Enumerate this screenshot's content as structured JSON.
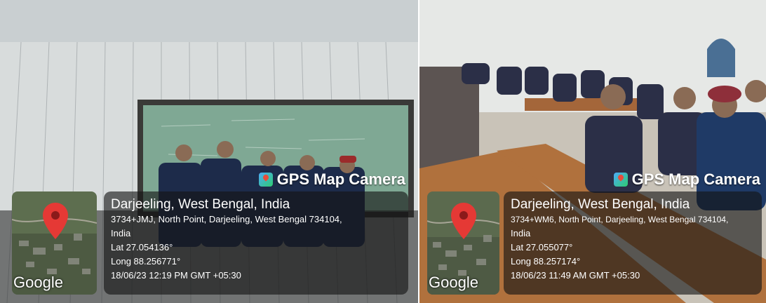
{
  "photos": [
    {
      "badge": "GPS Map Camera",
      "place": "Darjeeling, West Bengal, India",
      "address1": "3734+JMJ, North Point, Darjeeling, West Bengal 734104,",
      "address2": "India",
      "lat": "Lat 27.054136°",
      "long": "Long 88.256771°",
      "datetime": "18/06/23 12:19 PM GMT +05:30",
      "map_logo": "Google"
    },
    {
      "badge": "GPS Map Camera",
      "place": "Darjeeling, West Bengal, India",
      "address1": "3734+WM6, North Point, Darjeeling, West Bengal 734104,",
      "address2": "India",
      "lat": "Lat 27.055077°",
      "long": "Long 88.257174°",
      "datetime": "18/06/23 11:49 AM GMT +05:30",
      "map_logo": "Google"
    }
  ]
}
